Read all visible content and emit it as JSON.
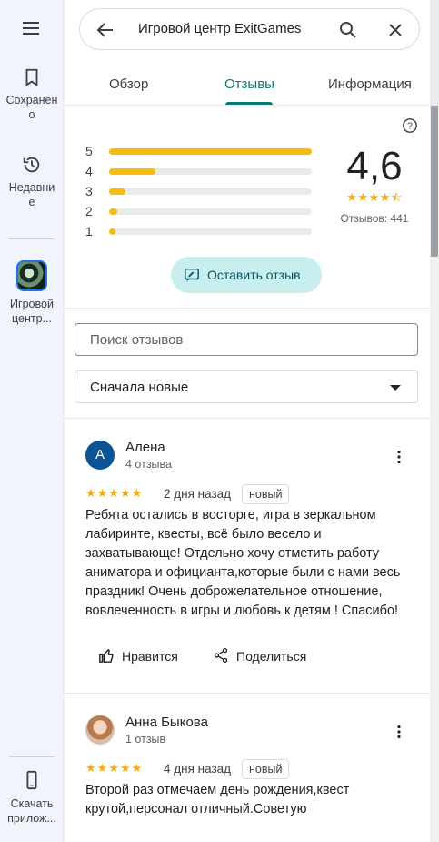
{
  "rail": {
    "saved_label": "Сохранено",
    "recent_label": "Недавние",
    "place_label": "Игровой центр...",
    "download_label": "Скачать прилож..."
  },
  "search": {
    "query": "Игровой центр ExitGames"
  },
  "tabs": [
    {
      "label": "Обзор"
    },
    {
      "label": "Отзывы"
    },
    {
      "label": "Информация"
    }
  ],
  "summary": {
    "rating": "4,6",
    "stars": "★★★★⯪",
    "count_label": "Отзывов: 441",
    "distribution": [
      {
        "label": "5",
        "share": 1.0
      },
      {
        "label": "4",
        "share": 0.23
      },
      {
        "label": "3",
        "share": 0.08
      },
      {
        "label": "2",
        "share": 0.04
      },
      {
        "label": "1",
        "share": 0.03
      }
    ],
    "write_label": "Оставить отзыв"
  },
  "filters": {
    "search_placeholder": "Поиск отзывов",
    "sort_label": "Сначала новые"
  },
  "reviews": [
    {
      "avatar_letter": "A",
      "name": "Алена",
      "sub": "4 отзыва",
      "stars": "★★★★★",
      "date": "2 дня назад",
      "badge": "новый",
      "text": "Ребята остались в восторге, игра в зеркальном лабиринте, квесты, всё было весело и захватывающе! Отдельно хочу отметить работу аниматора и официанта,которые были с нами весь праздник! Очень доброжелательное отношение, вовлеченность в игры и любовь к детям ! Спасибо!",
      "like_label": "Нравится",
      "share_label": "Поделиться"
    },
    {
      "avatar_letter": "",
      "name": "Анна Быкова",
      "sub": "1 отзыв",
      "stars": "★★★★★",
      "date": "4 дня назад",
      "badge": "новый",
      "text": "Второй раз отмечаем день рождения,квест крутой,персонал отличный.Советую"
    }
  ]
}
